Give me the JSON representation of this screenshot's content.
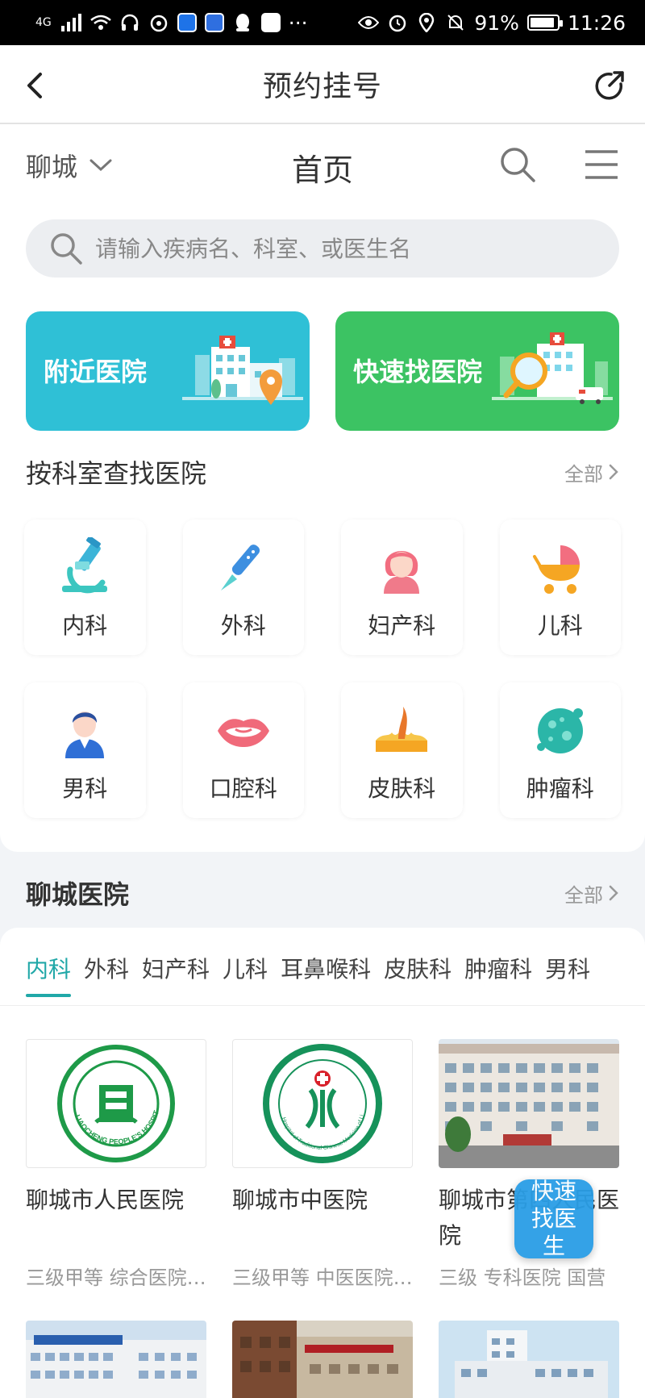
{
  "status_bar": {
    "network": "4G",
    "battery_percent": "91%",
    "battery_level": 0.91,
    "time": "11:26",
    "more": "···"
  },
  "navbar": {
    "title": "预约挂号"
  },
  "topbar": {
    "city": "聊城",
    "title": "首页"
  },
  "search": {
    "placeholder": "请输入疾病名、科室、或医生名"
  },
  "banners": [
    {
      "label": "附近医院",
      "color": "#2fc0d6"
    },
    {
      "label": "快速找医院",
      "color": "#3cc363"
    }
  ],
  "dept_section": {
    "title": "按科室查找医院",
    "more": "全部"
  },
  "departments": [
    {
      "label": "内科",
      "icon": "microscope-icon"
    },
    {
      "label": "外科",
      "icon": "scalpel-icon"
    },
    {
      "label": "妇产科",
      "icon": "woman-icon"
    },
    {
      "label": "儿科",
      "icon": "stroller-icon"
    },
    {
      "label": "男科",
      "icon": "man-icon"
    },
    {
      "label": "口腔科",
      "icon": "mouth-icon"
    },
    {
      "label": "皮肤科",
      "icon": "skin-icon"
    },
    {
      "label": "肿瘤科",
      "icon": "tumor-icon"
    }
  ],
  "hospital_section": {
    "title": "聊城医院",
    "more": "全部"
  },
  "tabs": [
    "内科",
    "外科",
    "妇产科",
    "儿科",
    "耳鼻喉科",
    "皮肤科",
    "肿瘤科",
    "男科"
  ],
  "hospitals": [
    {
      "name": "聊城市人民医院",
      "meta": "三级甲等 综合医院 公立",
      "logo_text": "LIAOCHENG PEOPLE'S HOSPITAL"
    },
    {
      "name": "聊城市中医院",
      "meta": "三级甲等 中医医院 公立",
      "logo_text": "Hospital of Traditional Chinese Medicine of Liaocheng City"
    },
    {
      "name": "聊城市第四人民医院",
      "meta": "三级 专科医院 国营"
    }
  ],
  "fab": {
    "label": "快速找医生"
  },
  "colors": {
    "accent": "#21a8a8",
    "fab": "#2a9ee6",
    "hospital_green": "#1e9a48"
  }
}
